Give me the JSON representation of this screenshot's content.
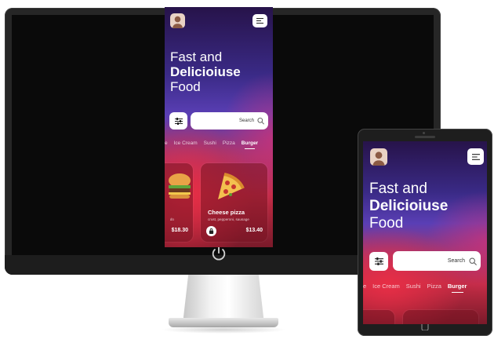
{
  "app": {
    "headline": [
      "Fast and",
      "Delicioiuse",
      "Food"
    ],
    "search": {
      "label": "Search"
    },
    "categories": [
      "e",
      "Ice Cream",
      "Sushi",
      "Pizza",
      "Burger"
    ],
    "active_category": "Burger",
    "cards": [
      {
        "name": "",
        "desc_fragment": "do",
        "price": "$18.30"
      },
      {
        "name": "Cheese pizza",
        "desc": "crust, pepperoni, sausage",
        "price": "$13.40"
      }
    ]
  },
  "icons": {
    "menu": "menu-icon",
    "filter": "sliders-icon",
    "search": "search-icon",
    "bag": "shopping-bag-icon",
    "power": "power-icon",
    "home": "home-button-icon"
  },
  "colors": {
    "gradient_top": "#27134a",
    "gradient_mid": "#5a3fb5",
    "gradient_red": "#c42c45",
    "card": "#7a1a2a"
  }
}
